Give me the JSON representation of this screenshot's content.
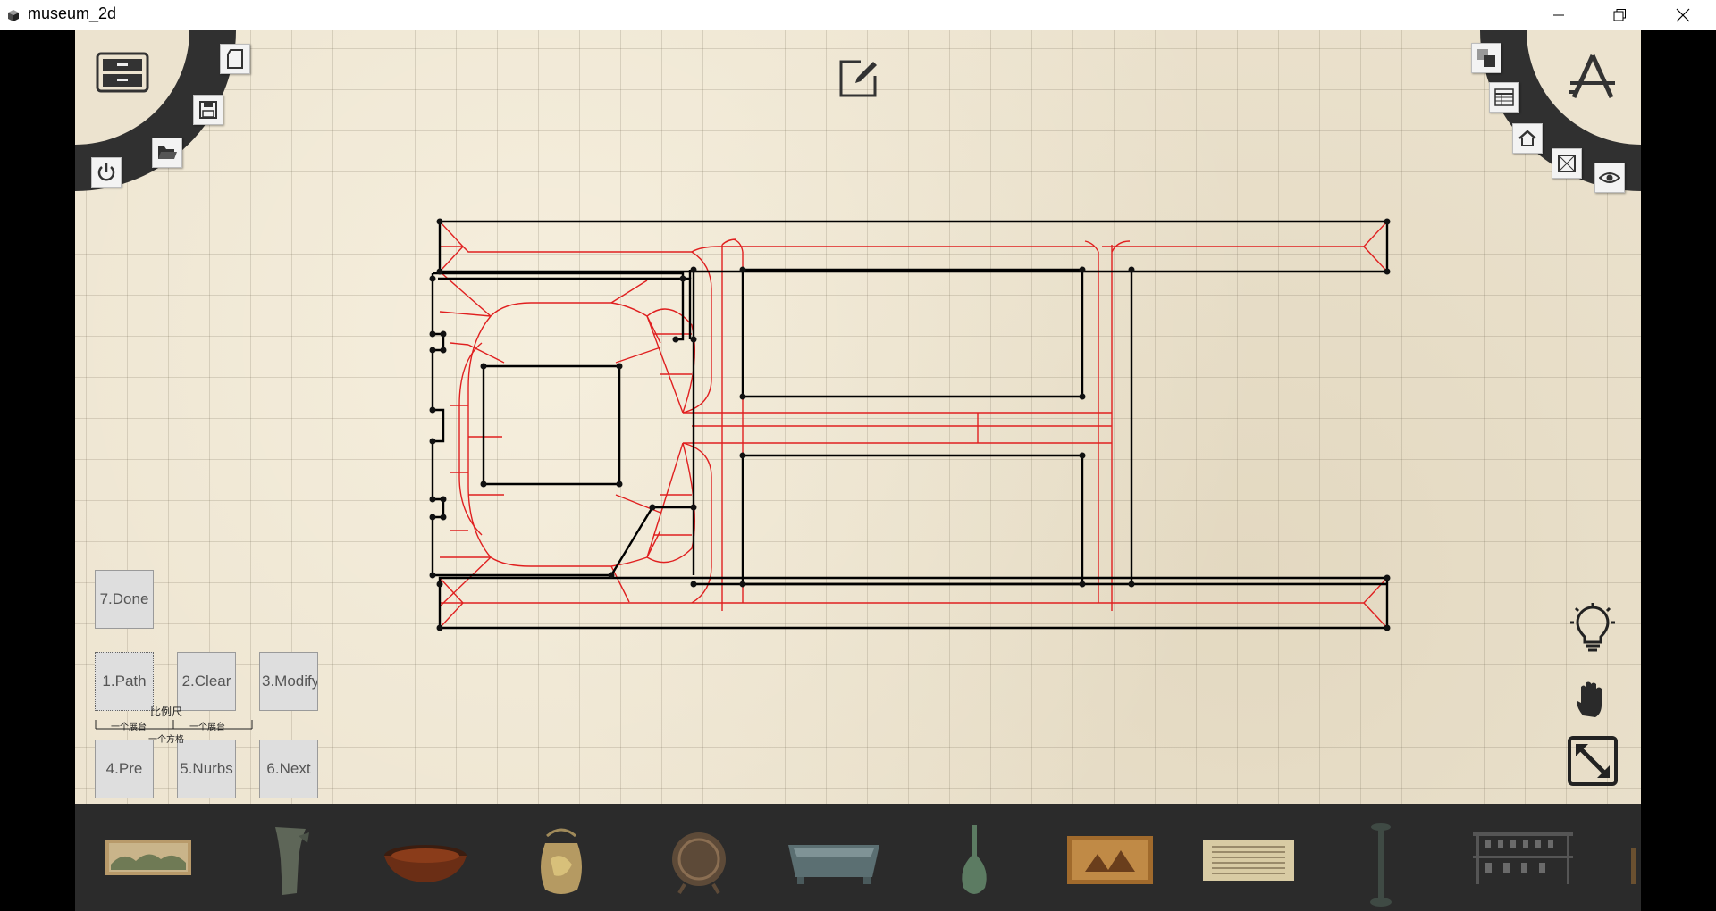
{
  "window": {
    "title": "museum_2d",
    "icons": [
      "app-cube-icon",
      "minimize-icon",
      "restore-icon",
      "close-icon"
    ]
  },
  "left_tools": [
    "archive-drawer-icon",
    "new-file-icon",
    "save-icon",
    "open-folder-icon",
    "power-icon"
  ],
  "top_center_tool": "edit-note-icon",
  "right_tools": [
    "layers-icon",
    "table-icon",
    "home-icon",
    "frame-icon",
    "eye-icon",
    "architect-compass-icon"
  ],
  "right_side_tools": [
    "lightbulb-icon",
    "hand-pan-icon",
    "fullscreen-expand-icon"
  ],
  "controls": {
    "done": "7.Done",
    "path": "1.Path",
    "clear": "2.Clear",
    "modify": "3.Modify",
    "pre": "4.Pre",
    "nurbs": "5.Nurbs",
    "next": "6.Next"
  },
  "scale_legend": {
    "title": "比例尺",
    "left_label": "一个展台",
    "right_label": "一个展台",
    "bottom_label": "一个方格"
  },
  "colors": {
    "canvas_bg": "#ece3cf",
    "wall": "#000000",
    "path": "#e02020",
    "bar_bg": "#2b2b2b"
  },
  "artifacts": [
    "scroll-painting-icon",
    "bronze-horn-vessel-icon",
    "lacquer-bowl-icon",
    "gilded-pot-icon",
    "bronze-censer-icon",
    "bronze-basin-icon",
    "celadon-vase-icon",
    "framed-painting-icon",
    "calligraphy-scroll-icon",
    "bronze-lamp-stand-icon",
    "bell-chime-icon",
    "partial-artifact-icon"
  ]
}
